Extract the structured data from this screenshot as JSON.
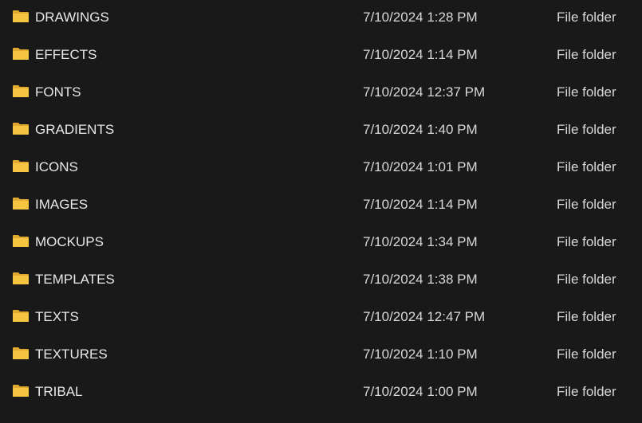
{
  "folder_icon": {
    "name": "folder-icon",
    "color_front": "#F5C542",
    "color_back": "#E0A82E"
  },
  "rows": [
    {
      "name": "DRAWINGS",
      "date": "7/10/2024 1:28 PM",
      "type": "File folder"
    },
    {
      "name": "EFFECTS",
      "date": "7/10/2024 1:14 PM",
      "type": "File folder"
    },
    {
      "name": "FONTS",
      "date": "7/10/2024 12:37 PM",
      "type": "File folder"
    },
    {
      "name": "GRADIENTS",
      "date": "7/10/2024 1:40 PM",
      "type": "File folder"
    },
    {
      "name": "ICONS",
      "date": "7/10/2024 1:01 PM",
      "type": "File folder"
    },
    {
      "name": "IMAGES",
      "date": "7/10/2024 1:14 PM",
      "type": "File folder"
    },
    {
      "name": "MOCKUPS",
      "date": "7/10/2024 1:34 PM",
      "type": "File folder"
    },
    {
      "name": "TEMPLATES",
      "date": "7/10/2024 1:38 PM",
      "type": "File folder"
    },
    {
      "name": "TEXTS",
      "date": "7/10/2024 12:47 PM",
      "type": "File folder"
    },
    {
      "name": "TEXTURES",
      "date": "7/10/2024 1:10 PM",
      "type": "File folder"
    },
    {
      "name": "TRIBAL",
      "date": "7/10/2024 1:00 PM",
      "type": "File folder"
    }
  ]
}
